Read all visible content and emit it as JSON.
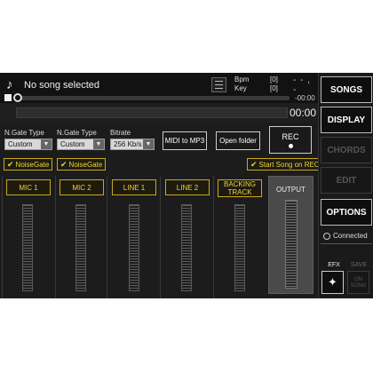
{
  "player": {
    "song_title": "No song selected",
    "bpm_label": "Bpm",
    "bpm_value": "[0]",
    "key_label": "Key",
    "key_value": "[0]",
    "time_remaining_top": "- - , -",
    "time_remaining": "-00:00",
    "elapsed": "00:00",
    "seek_fraction": 0,
    "progress_fraction": 0
  },
  "settings": {
    "ngate1_label": "N.Gate Type",
    "ngate1_value": "Custom",
    "ngate2_label": "N.Gate Type",
    "ngate2_value": "Custom",
    "bitrate_label": "Bitrate",
    "bitrate_value": "256 Kb/s",
    "midi_button": "MIDI to MP3",
    "open_folder_button": "Open folder",
    "rec_button": "REC"
  },
  "checkboxes": {
    "noisegate1": "NoiseGate",
    "noisegate2": "NoiseGate",
    "start_on_rec": "Start Song on REC"
  },
  "channels": [
    {
      "label": "MIC 1"
    },
    {
      "label": "MIC 2"
    },
    {
      "label": "LINE 1"
    },
    {
      "label": "LINE 2"
    },
    {
      "label": "BACKING TRACK"
    }
  ],
  "output": {
    "label": "OUTPUT"
  },
  "sidebar": {
    "songs": "SONGS",
    "display": "DISPLAY",
    "chords": "CHORDS",
    "edit": "EDIT",
    "options": "OPTIONS",
    "status": "Connected",
    "efx": "EFX",
    "save": "SAVE",
    "on_song": "ON SONG"
  },
  "colors": {
    "accent": "#f1d23a",
    "background": "#1c1c1c"
  },
  "icons": {
    "note": "music-note-icon",
    "list": "playlist-icon",
    "efx": "magic-wand-icon",
    "globe": "globe-icon"
  }
}
